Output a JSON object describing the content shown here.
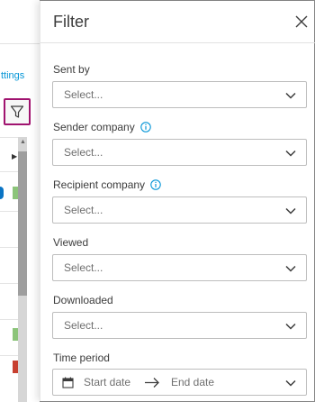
{
  "background": {
    "settings_link_text": "ttings",
    "accent_color": "#a0136f"
  },
  "panel": {
    "title": "Filter",
    "fields": [
      {
        "label": "Sent by",
        "value": "Select...",
        "has_info": false
      },
      {
        "label": "Sender company",
        "value": "Select...",
        "has_info": true
      },
      {
        "label": "Recipient company",
        "value": "Select...",
        "has_info": true
      },
      {
        "label": "Viewed",
        "value": "Select...",
        "has_info": false
      },
      {
        "label": "Downloaded",
        "value": "Select...",
        "has_info": false
      }
    ],
    "time_period": {
      "label": "Time period",
      "start_placeholder": "Start date",
      "end_placeholder": "End date"
    }
  },
  "colors": {
    "link": "#0696d7",
    "info_icon": "#0696d7",
    "text": "#3c3c3c",
    "placeholder": "#6f6f6f"
  }
}
